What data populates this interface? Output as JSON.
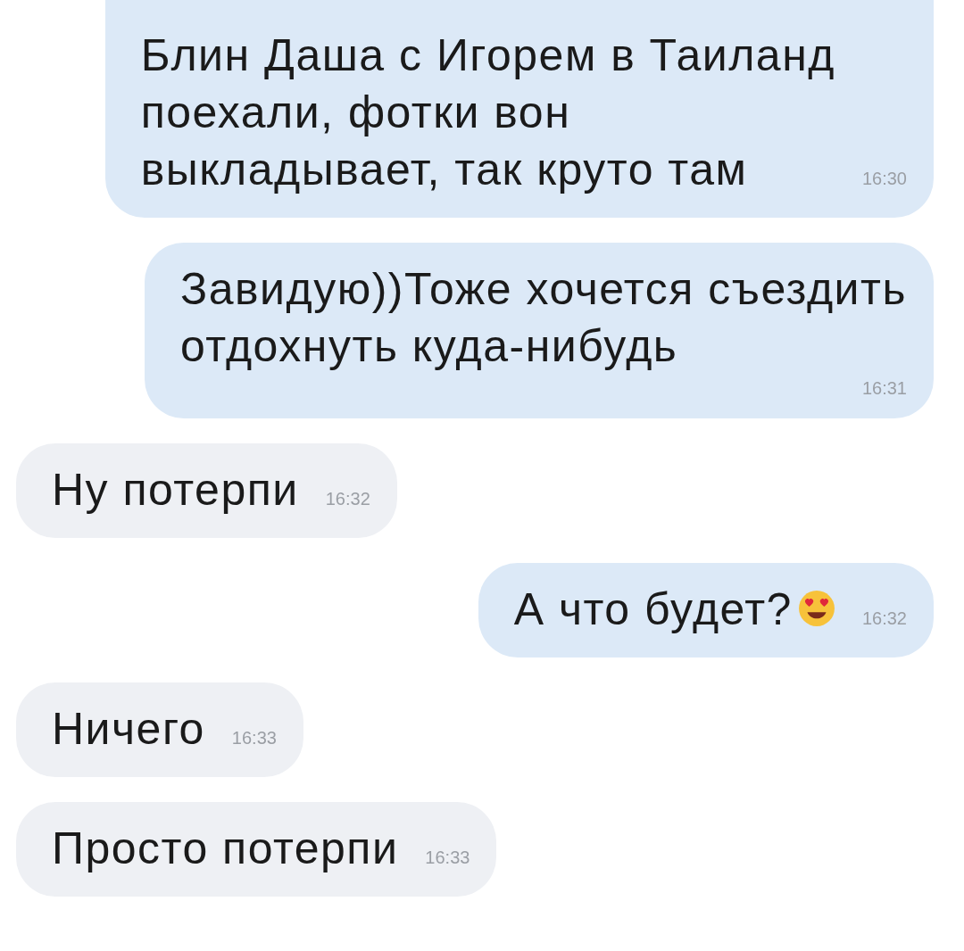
{
  "messages": [
    {
      "kind": "sent",
      "text": "Блин Даша с Игорем в Таиланд\nпоехали, фотки вон\nвыкладывает, так круто там",
      "time": "16:30",
      "time_below": false,
      "emoji_after_text": false
    },
    {
      "kind": "sent",
      "text": "Завидую))Тоже хочется съездить\nотдохнуть куда-нибудь",
      "time": "16:31",
      "time_below": true,
      "emoji_after_text": false
    },
    {
      "kind": "received",
      "text": "Ну потерпи",
      "time": "16:32",
      "time_below": false,
      "emoji_after_text": false
    },
    {
      "kind": "sent",
      "text": "А что будет?",
      "time": "16:32",
      "time_below": false,
      "emoji_after_text": true
    },
    {
      "kind": "received",
      "text": "Ничего",
      "time": "16:33",
      "time_below": false,
      "emoji_after_text": false
    },
    {
      "kind": "received",
      "text": "Просто потерпи",
      "time": "16:33",
      "time_below": false,
      "emoji_after_text": false
    }
  ]
}
